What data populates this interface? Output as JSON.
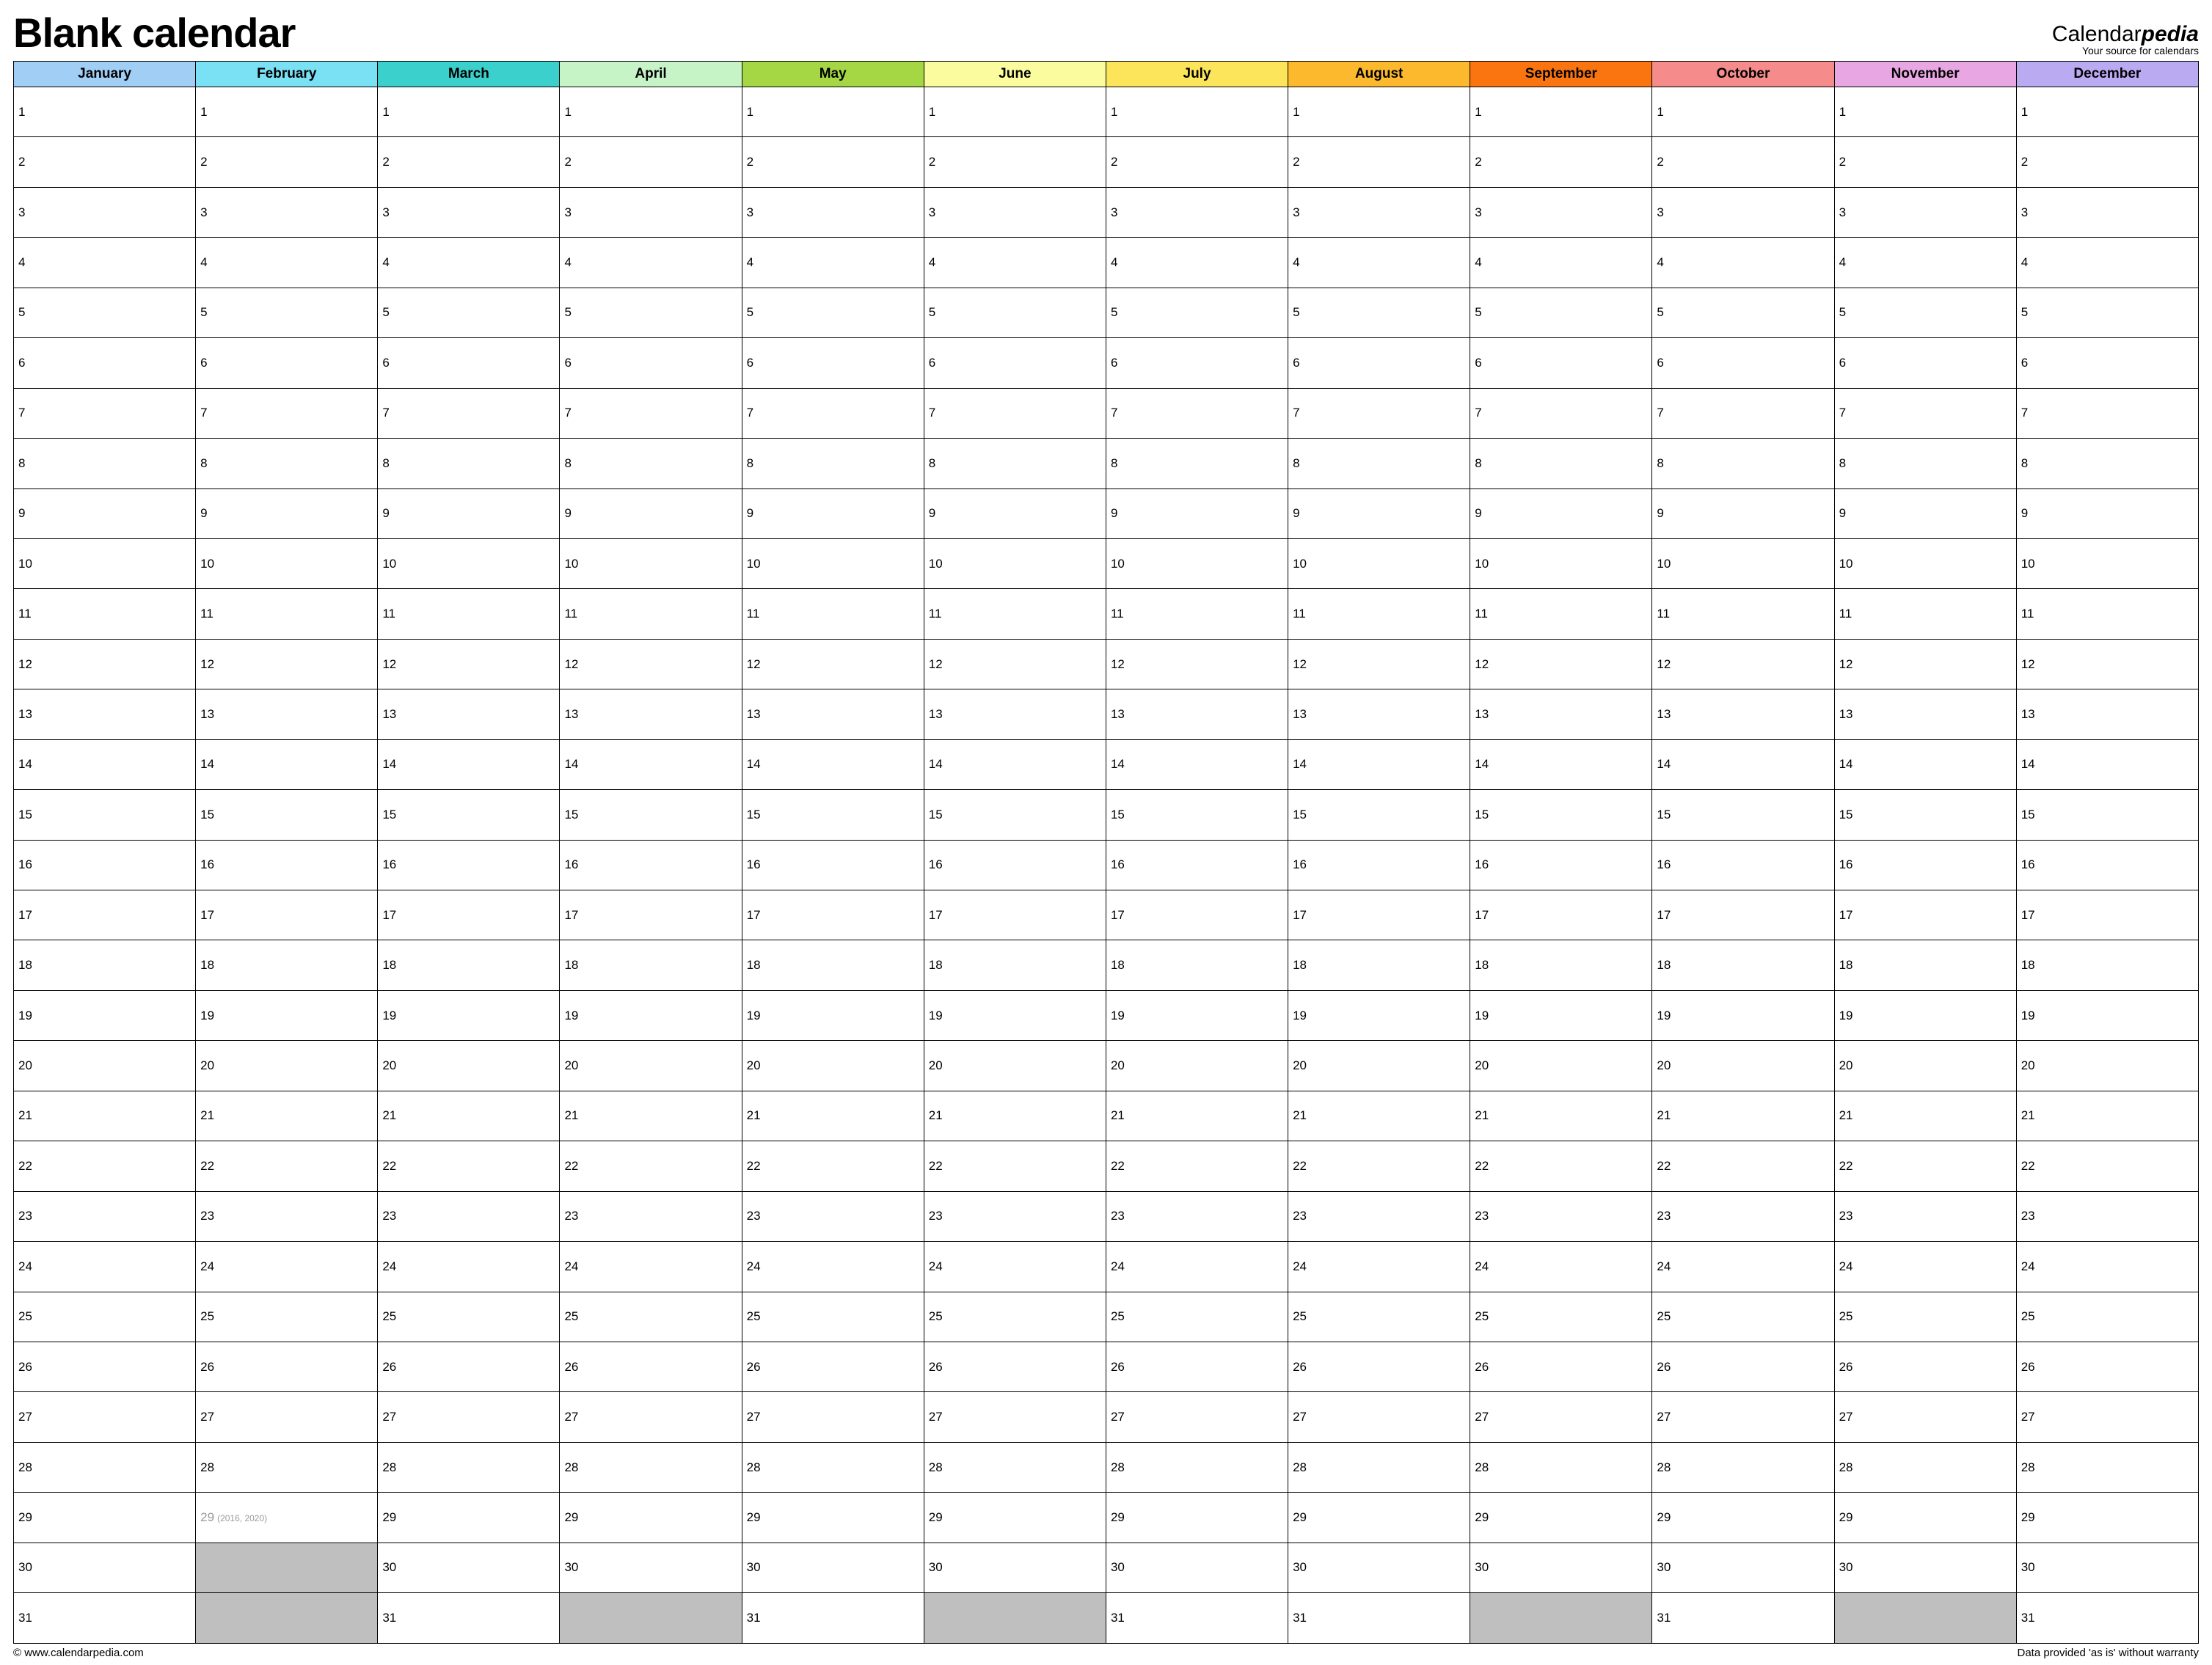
{
  "title": "Blank calendar",
  "brand": {
    "prefix": "Calendar",
    "suffix": "pedia",
    "tagline": "Your source for calendars"
  },
  "months": [
    {
      "name": "January",
      "days": 31
    },
    {
      "name": "February",
      "days": 28,
      "leap": {
        "day": 29,
        "note": "(2016, 2020)"
      }
    },
    {
      "name": "March",
      "days": 31
    },
    {
      "name": "April",
      "days": 30
    },
    {
      "name": "May",
      "days": 31
    },
    {
      "name": "June",
      "days": 30
    },
    {
      "name": "July",
      "days": 31
    },
    {
      "name": "August",
      "days": 31
    },
    {
      "name": "September",
      "days": 30
    },
    {
      "name": "October",
      "days": 31
    },
    {
      "name": "November",
      "days": 30
    },
    {
      "name": "December",
      "days": 31
    }
  ],
  "max_rows": 31,
  "footer": {
    "copyright": "© www.calendarpedia.com",
    "disclaimer": "Data provided 'as is' without warranty"
  }
}
